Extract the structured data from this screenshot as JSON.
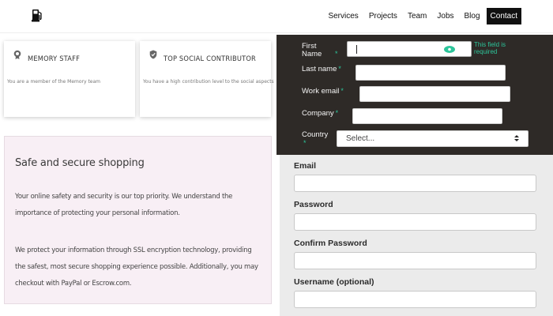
{
  "nav": {
    "logo_icon": "gas-pump-icon",
    "items": [
      {
        "label": "Services"
      },
      {
        "label": "Projects"
      },
      {
        "label": "Team"
      },
      {
        "label": "Jobs"
      },
      {
        "label": "Blog"
      },
      {
        "label": "Contact",
        "active": true
      }
    ]
  },
  "cards": [
    {
      "icon": "badge-icon",
      "title": "MEMORY STAFF",
      "description": "You are a member of the Memory team"
    },
    {
      "icon": "shield-check-icon",
      "title": "TOP SOCIAL CONTRIBUTOR",
      "description": "You have a high contribution level to the social aspects"
    }
  ],
  "secure": {
    "title": "Safe and secure shopping",
    "paragraph1": "Your online safety and security is our top priority. We understand the importance of protecting your personal information.",
    "paragraph2": "We protect your information through SSL encryption technology, providing the safest, most secure shopping experience possible. Additionally, you may checkout with PayPal or Escrow.com."
  },
  "dark_form": {
    "first_name_label": "First Name",
    "first_name_value": "",
    "required_marker": "*",
    "tooltip": "This field is required",
    "last_name_label": "Last name",
    "work_email_label": "Work email",
    "company_label": "Company",
    "country_label": "Country",
    "country_value": "Select..."
  },
  "light_form": {
    "email_label": "Email",
    "password_label": "Password",
    "confirm_password_label": "Confirm Password",
    "username_label": "Username (optional)"
  },
  "colors": {
    "accent_green": "#2cc59a",
    "dark_form_bg": "#2e2a27",
    "nav_active_bg": "#111111",
    "secure_panel_bg": "#f8eff5",
    "light_form_bg": "#ebebeb"
  }
}
